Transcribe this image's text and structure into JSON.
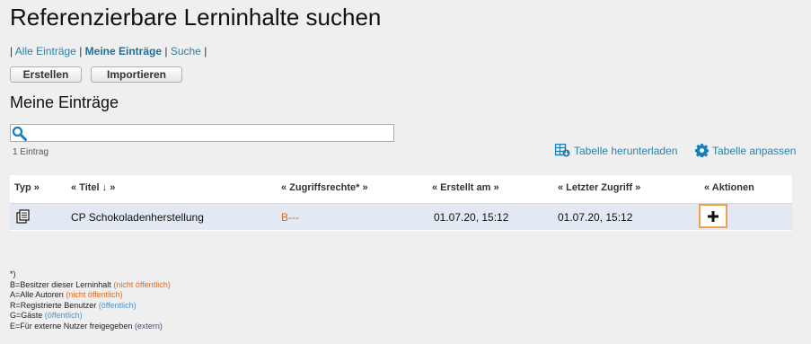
{
  "page": {
    "title": "Referenzierbare Lerninhalte suchen"
  },
  "nav": {
    "links": [
      "Alle Einträge",
      "Meine Einträge",
      "Suche"
    ],
    "active": "Meine Einträge",
    "separator": "|"
  },
  "buttons": {
    "create": "Erstellen",
    "import": "Importieren"
  },
  "section": {
    "title": "Meine Einträge"
  },
  "search": {
    "value": "",
    "placeholder": ""
  },
  "result_count": "1 Eintrag",
  "tools": {
    "download": "Tabelle herunterladen",
    "customize": "Tabelle anpassen"
  },
  "table": {
    "headers": {
      "type": "Typ »",
      "title": "« Titel ↓ »",
      "rights": "« Zugriffsrechte* »",
      "created": "« Erstellt am »",
      "last_access": "« Letzter Zugriff »",
      "actions": "« Aktionen"
    },
    "rows": [
      {
        "type_icon": "document-stack-icon",
        "title": "CP Schokoladenherstellung",
        "rights": "B---",
        "created": "01.07.20, 15:12",
        "last_access": "01.07.20, 15:12",
        "action": "+"
      }
    ]
  },
  "footnotes": {
    "marker": "*)",
    "items": [
      {
        "text": "B=Besitzer dieser Lerninhalt",
        "visibility": "(nicht öffentlich)"
      },
      {
        "text": "A=Alle Autoren",
        "visibility": "(nicht öffentlich)"
      },
      {
        "text": "R=Registrierte Benutzer",
        "visibility": "(öffentlich)"
      },
      {
        "text": "G=Gäste",
        "visibility": "(öffentlich)"
      },
      {
        "text": "E=Für externe Nutzer freigegeben",
        "visibility": "(extern)"
      }
    ]
  },
  "colors": {
    "link": "#2a7fa6",
    "rights_orange": "#e06a18",
    "public_blue": "#4a95cc",
    "external_navy": "#3a4f8f",
    "highlight_orange": "#f0a04b",
    "row_background": "#e3e9f3"
  }
}
